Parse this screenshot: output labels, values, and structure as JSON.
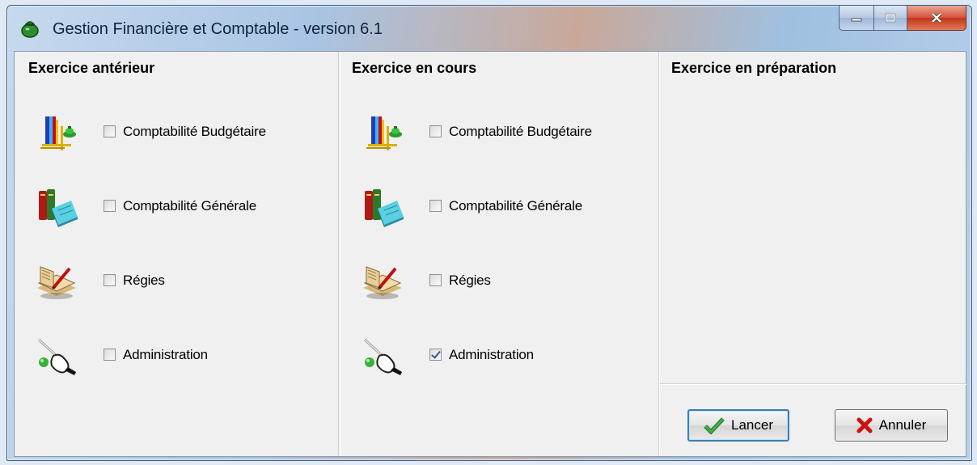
{
  "window": {
    "title": "Gestion Financière et Comptable - version 6.1",
    "icon": "money-bag-icon"
  },
  "caption_buttons": [
    "minimize",
    "maximize",
    "close"
  ],
  "panels": [
    {
      "title": "Exercice antérieur",
      "items": [
        {
          "label": "Comptabilité Budgétaire",
          "icon": "budget-scale-icon",
          "checked": false
        },
        {
          "label": "Comptabilité Générale",
          "icon": "ledger-books-icon",
          "checked": false
        },
        {
          "label": "Régies",
          "icon": "book-pen-icon",
          "checked": false
        },
        {
          "label": "Administration",
          "icon": "admin-hand-wand-icon",
          "checked": false
        }
      ]
    },
    {
      "title": "Exercice en cours",
      "items": [
        {
          "label": "Comptabilité Budgétaire",
          "icon": "budget-scale-icon",
          "checked": false
        },
        {
          "label": "Comptabilité Générale",
          "icon": "ledger-books-icon",
          "checked": false
        },
        {
          "label": "Régies",
          "icon": "book-pen-icon",
          "checked": false
        },
        {
          "label": "Administration",
          "icon": "admin-hand-wand-icon",
          "checked": true
        }
      ]
    },
    {
      "title": "Exercice en préparation",
      "items": []
    }
  ],
  "buttons": {
    "launch": {
      "label": "Lancer",
      "icon": "checkmark-icon"
    },
    "cancel": {
      "label": "Annuler",
      "icon": "red-x-icon"
    }
  },
  "colors": {
    "accent": "#3c7fb1",
    "check": "#2a5d9b",
    "cancel_x": "#d01010",
    "launch_check": "#2e8b2e"
  }
}
